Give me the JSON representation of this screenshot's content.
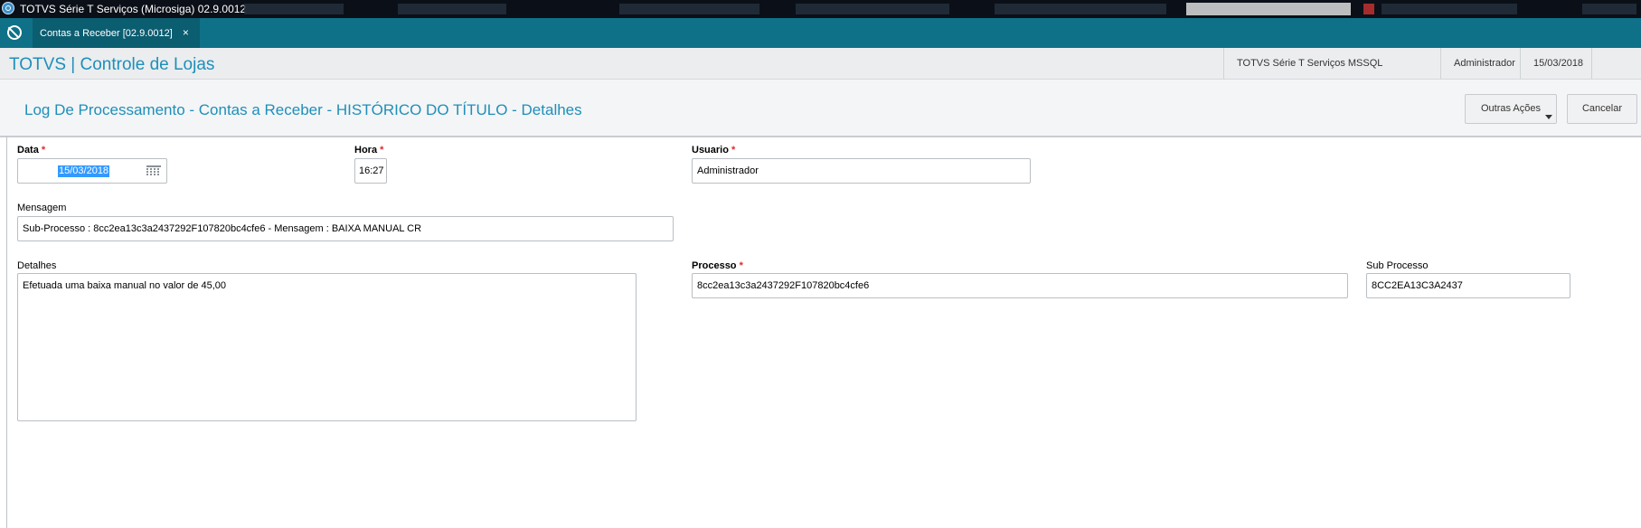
{
  "window": {
    "title": "TOTVS Série T Serviços (Microsiga) 02.9.0012"
  },
  "tabbar": {
    "tab_label": "Contas a Receber [02.9.0012]",
    "tab_close": "×"
  },
  "header": {
    "brand": "TOTVS | Controle de Lojas",
    "environment": "TOTVS Série T Serviços MSSQL",
    "user": "Administrador",
    "date": "15/03/2018"
  },
  "page": {
    "title": "Log De Processamento - Contas a Receber - HISTÓRICO DO TÍTULO - Detalhes",
    "other_actions_label": "Outras Ações",
    "cancel_label": "Cancelar"
  },
  "form": {
    "required_mark": "*",
    "data": {
      "label": "Data",
      "value": "15/03/2018",
      "required": true
    },
    "hora": {
      "label": "Hora",
      "value": "16:27",
      "required": true
    },
    "usuario": {
      "label": "Usuario",
      "value": "Administrador",
      "required": true
    },
    "mensagem": {
      "label": "Mensagem",
      "value": "Sub-Processo : 8cc2ea13c3a2437292F107820bc4cfe6 - Mensagem : BAIXA MANUAL CR"
    },
    "detalhes": {
      "label": "Detalhes",
      "value": "Efetuada uma baixa manual no valor de 45,00"
    },
    "processo": {
      "label": "Processo",
      "value": "8cc2ea13c3a2437292F107820bc4cfe6",
      "required": true
    },
    "sub_processo": {
      "label": "Sub Processo",
      "value": "8CC2EA13C3A2437"
    }
  },
  "colors": {
    "teal_bar": "#0e7188",
    "brand_blue": "#1e8fba",
    "required_red": "#e8252b",
    "selection_blue": "#3399ff"
  }
}
